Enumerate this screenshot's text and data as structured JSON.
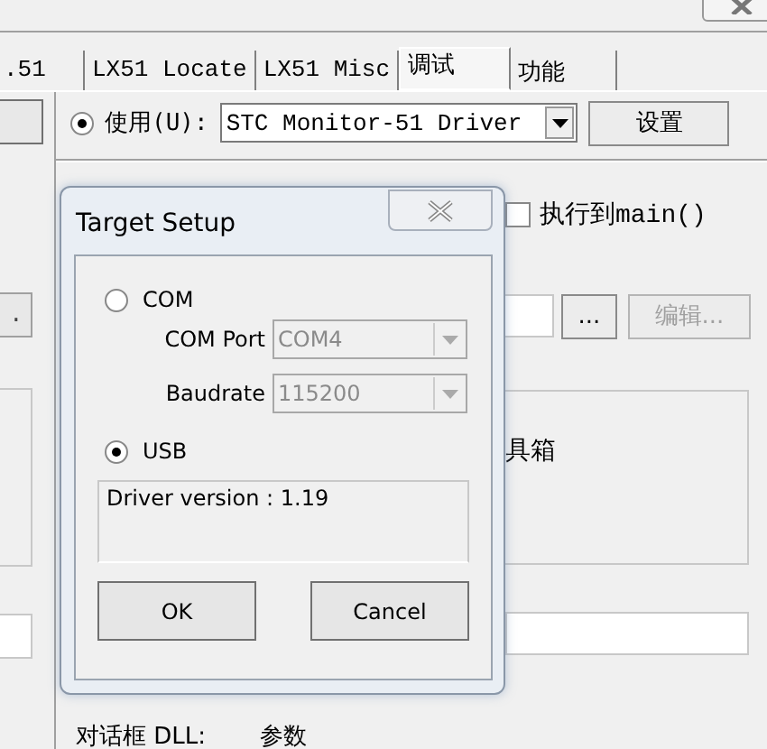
{
  "tabs": [
    {
      "label": ".51",
      "selected": false
    },
    {
      "label": "LX51 Locate",
      "selected": false
    },
    {
      "label": "LX51 Misc",
      "selected": false
    },
    {
      "label": "调试",
      "selected": true
    },
    {
      "label": "功能",
      "selected": false
    }
  ],
  "debugger": {
    "use_label": "使用(U):",
    "use_selected": true,
    "driver": "STC Monitor-51 Driver",
    "settings_button": "设置"
  },
  "run_to_main": {
    "label": "执行到main()",
    "checked": false
  },
  "left_button": ".",
  "browse_button": "...",
  "edit_button": {
    "label": "编辑...",
    "disabled": true
  },
  "toolbox_label": "具箱",
  "dialog_dll_label": "对话框 DLL:",
  "params_label": "参数",
  "dialog": {
    "title": "Target Setup",
    "ports": [
      {
        "label": "COM",
        "selected": false
      },
      {
        "label": "USB",
        "selected": true
      }
    ],
    "com_port": {
      "label": "COM Port",
      "value": "COM4",
      "disabled": true
    },
    "baudrate": {
      "label": "Baudrate",
      "value": "115200",
      "disabled": true
    },
    "info": "Driver version : 1.19",
    "buttons": [
      "OK",
      "Cancel"
    ]
  }
}
